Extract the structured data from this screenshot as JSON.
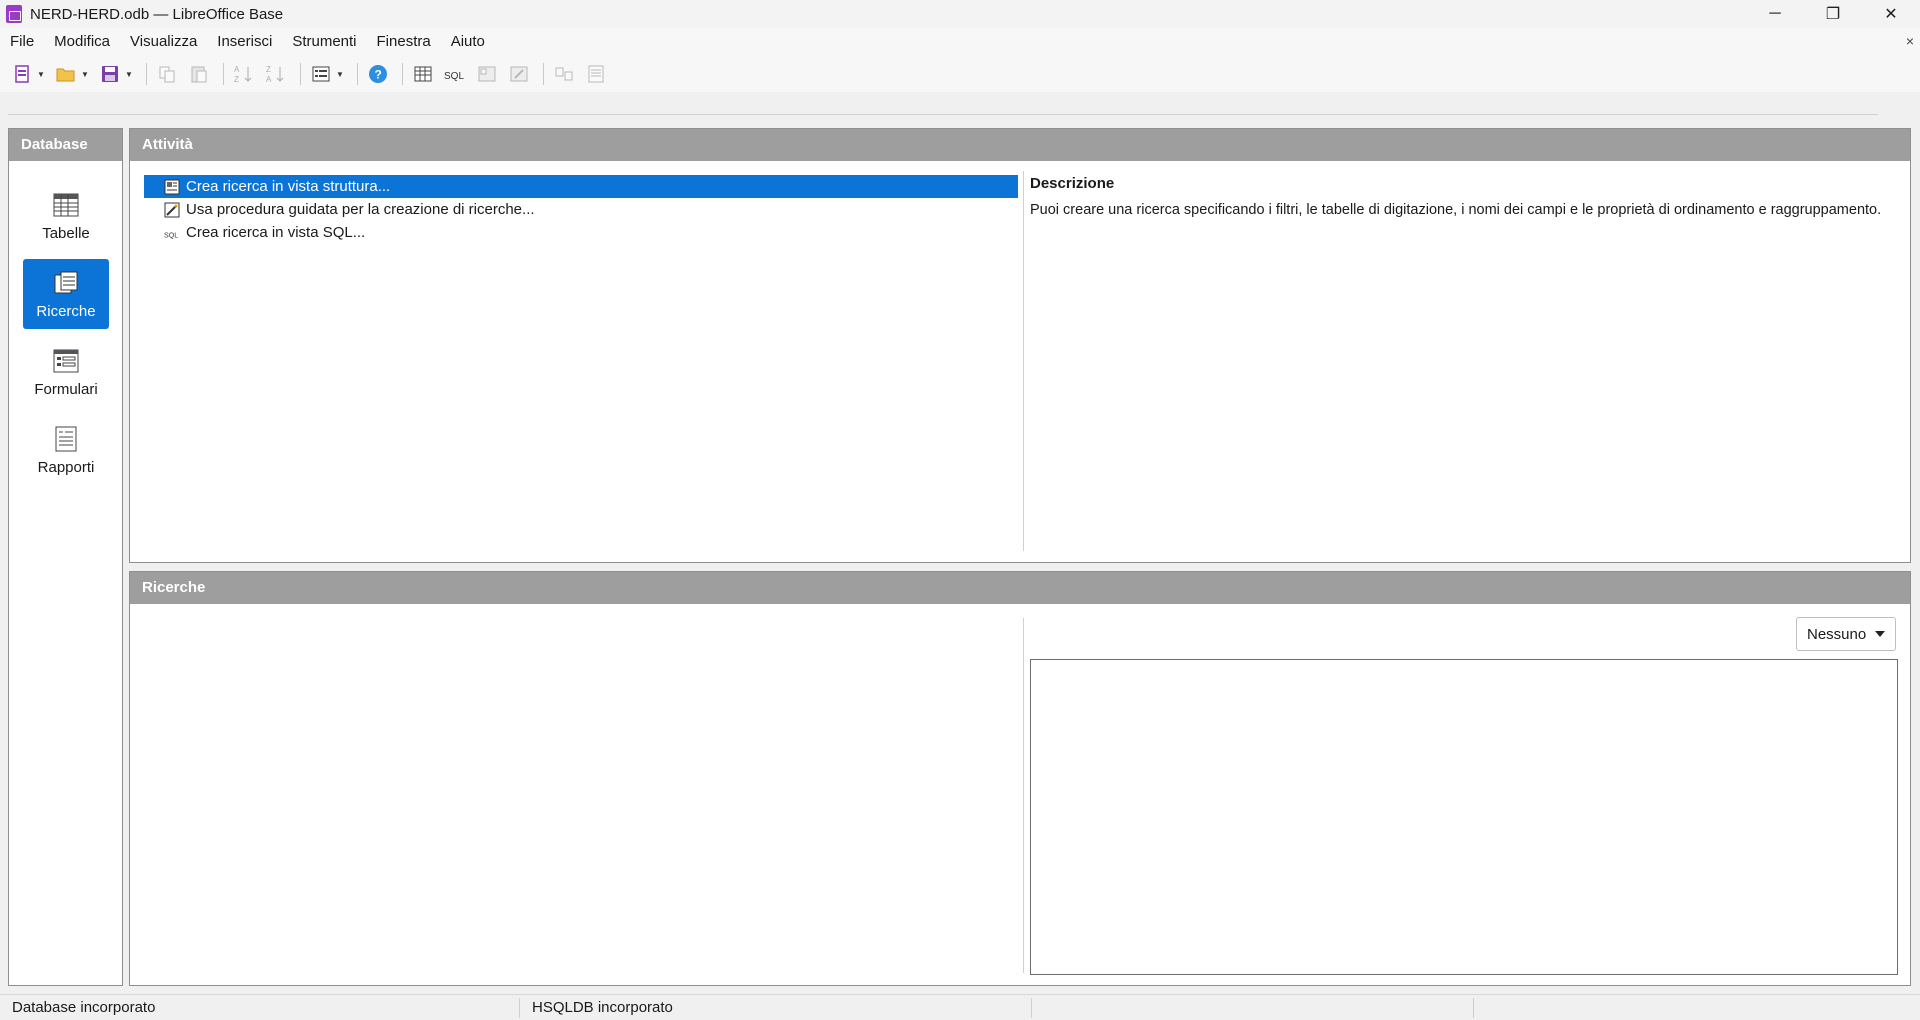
{
  "window": {
    "title": "NERD-HERD.odb — LibreOffice Base",
    "minimize": "─",
    "restore": "❐",
    "close": "✕"
  },
  "menubar": {
    "items": [
      "File",
      "Modifica",
      "Visualizza",
      "Inserisci",
      "Strumenti",
      "Finestra",
      "Aiuto"
    ],
    "close_doc": "×"
  },
  "toolbar": {
    "icons": [
      "new-icon",
      "open-icon",
      "save-icon",
      "copy-icon",
      "paste-icon",
      "sort-ascending-icon",
      "sort-descending-icon",
      "form-view-icon",
      "help-icon",
      "table-icon",
      "sql-icon",
      "query-design-icon",
      "query-edit-icon",
      "relation-icon",
      "report-icon"
    ]
  },
  "nav": {
    "header": "Database",
    "items": [
      {
        "label": "Tabelle",
        "icon": "table-icon",
        "active": false
      },
      {
        "label": "Ricerche",
        "icon": "query-icon",
        "active": true
      },
      {
        "label": "Formulari",
        "icon": "form-icon",
        "active": false
      },
      {
        "label": "Rapporti",
        "icon": "report-icon",
        "active": false
      }
    ]
  },
  "tasks": {
    "header": "Attività",
    "items": [
      {
        "label": "Crea ricerca in vista struttura...",
        "icon": "design-view-icon",
        "selected": true
      },
      {
        "label": "Usa procedura guidata per la creazione di ricerche...",
        "icon": "wizard-icon",
        "selected": false
      },
      {
        "label": "Crea ricerca in vista SQL...",
        "icon": "sql-icon",
        "selected": false
      }
    ],
    "description_title": "Descrizione",
    "description_text": "Puoi creare una ricerca specificando i filtri, le tabelle di digitazione, i nomi dei campi e le proprietà di ordinamento e raggruppamento."
  },
  "queries": {
    "header": "Ricerche",
    "preview_select": "Nessuno"
  },
  "statusbar": {
    "left": "Database incorporato",
    "middle": "HSQLDB incorporato",
    "right": ""
  },
  "colors": {
    "accent": "#0b74d6",
    "header_bg": "#9e9e9e"
  }
}
